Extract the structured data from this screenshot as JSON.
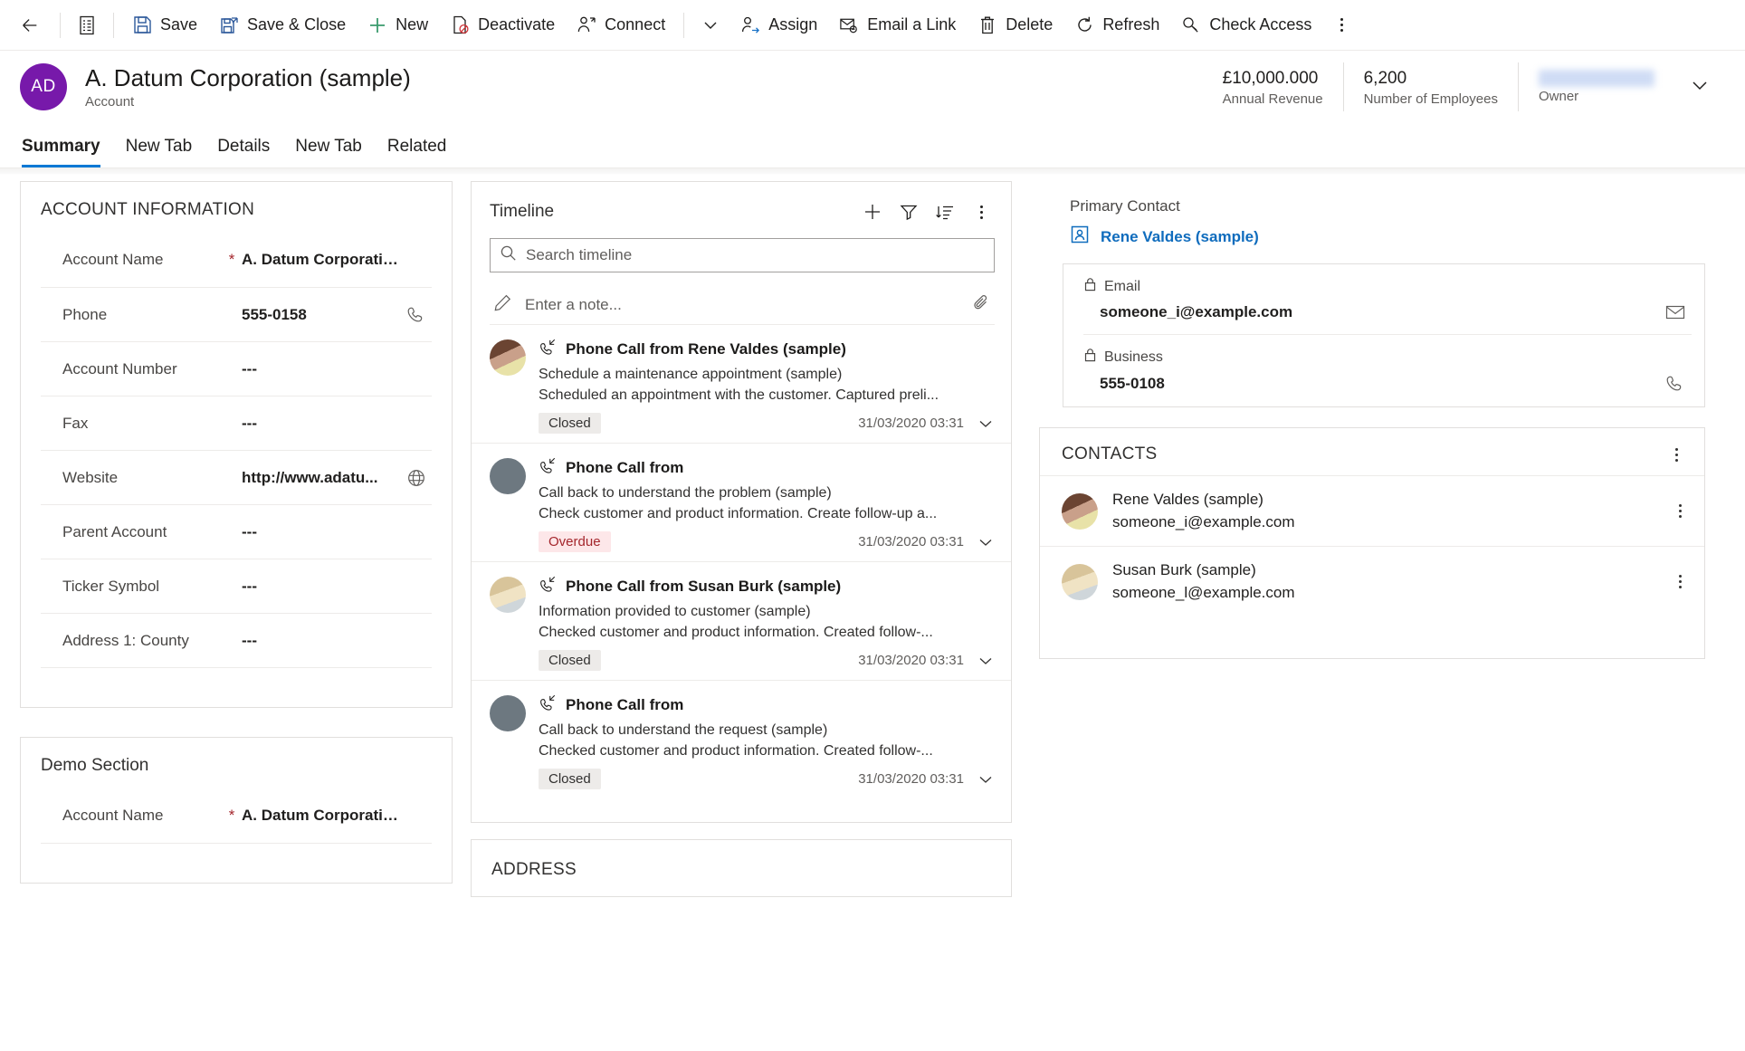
{
  "commandbar": {
    "back_label": "Back",
    "form_selector_label": "Form selector",
    "items": [
      {
        "label": "Save",
        "icon": "save-icon"
      },
      {
        "label": "Save & Close",
        "icon": "save-close-icon"
      },
      {
        "label": "New",
        "icon": "plus-icon"
      },
      {
        "label": "Deactivate",
        "icon": "deactivate-icon"
      },
      {
        "label": "Connect",
        "icon": "connect-icon"
      }
    ],
    "overflow_chevron": "chevron-down-icon",
    "items2": [
      {
        "label": "Assign",
        "icon": "assign-icon"
      },
      {
        "label": "Email a Link",
        "icon": "email-link-icon"
      },
      {
        "label": "Delete",
        "icon": "delete-icon"
      },
      {
        "label": "Refresh",
        "icon": "refresh-icon"
      },
      {
        "label": "Check Access",
        "icon": "key-icon"
      }
    ],
    "more_label": "More commands"
  },
  "header": {
    "avatar_initials": "AD",
    "title": "A. Datum Corporation (sample)",
    "subtitle": "Account",
    "stats": [
      {
        "value": "£10,000.000",
        "label": "Annual Revenue"
      },
      {
        "value": "6,200",
        "label": "Number of Employees"
      },
      {
        "value": "",
        "label": "Owner",
        "redacted": true
      }
    ]
  },
  "tabs": [
    {
      "label": "Summary",
      "active": true
    },
    {
      "label": "New Tab",
      "active": false
    },
    {
      "label": "Details",
      "active": false
    },
    {
      "label": "New Tab",
      "active": false
    },
    {
      "label": "Related",
      "active": false
    }
  ],
  "account_information": {
    "title": "ACCOUNT INFORMATION",
    "fields": [
      {
        "label": "Account Name",
        "required": true,
        "value": "A. Datum Corporation ...",
        "icon": ""
      },
      {
        "label": "Phone",
        "required": false,
        "value": "555-0158",
        "icon": "phone-icon"
      },
      {
        "label": "Account Number",
        "required": false,
        "value": "---",
        "icon": ""
      },
      {
        "label": "Fax",
        "required": false,
        "value": "---",
        "icon": ""
      },
      {
        "label": "Website",
        "required": false,
        "value": "http://www.adatu...",
        "icon": "globe-icon"
      },
      {
        "label": "Parent Account",
        "required": false,
        "value": "---",
        "icon": ""
      },
      {
        "label": "Ticker Symbol",
        "required": false,
        "value": "---",
        "icon": ""
      },
      {
        "label": "Address 1: County",
        "required": false,
        "value": "---",
        "icon": ""
      }
    ]
  },
  "demo_section": {
    "title": "Demo Section",
    "fields": [
      {
        "label": "Account Name",
        "required": true,
        "value": "A. Datum Corporation ...",
        "icon": ""
      }
    ]
  },
  "timeline": {
    "title": "Timeline",
    "actions": [
      {
        "name": "add-icon",
        "label": "Create a timeline record"
      },
      {
        "name": "filter-icon",
        "label": "Filter timeline"
      },
      {
        "name": "sort-icon",
        "label": "Sort timeline"
      },
      {
        "name": "more-icon",
        "label": "More timeline commands"
      }
    ],
    "search_placeholder": "Search timeline",
    "note_placeholder": "Enter a note...",
    "attach_label": "Attach file",
    "items": [
      {
        "title": "Phone Call from Rene Valdes (sample)",
        "subject": "Schedule a maintenance appointment (sample)",
        "description": "Scheduled an appointment with the customer. Captured preli...",
        "status": "Closed",
        "status_kind": "closed",
        "date": "31/03/2020 03:31",
        "avatar": "photo-female-1"
      },
      {
        "title": "Phone Call from",
        "subject": "Call back to understand the problem (sample)",
        "description": "Check customer and product information. Create follow-up a...",
        "status": "Overdue",
        "status_kind": "overdue",
        "date": "31/03/2020 03:31",
        "avatar": "placeholder"
      },
      {
        "title": "Phone Call from Susan Burk (sample)",
        "subject": "Information provided to customer (sample)",
        "description": "Checked customer and product information. Created follow-...",
        "status": "Closed",
        "status_kind": "closed",
        "date": "31/03/2020 03:31",
        "avatar": "photo-female-2"
      },
      {
        "title": "Phone Call from",
        "subject": "Call back to understand the request (sample)",
        "description": "Checked customer and product information. Created follow-...",
        "status": "Closed",
        "status_kind": "closed",
        "date": "31/03/2020 03:31",
        "avatar": "placeholder"
      }
    ]
  },
  "address": {
    "title": "ADDRESS"
  },
  "right_panel": {
    "primary_contact_label": "Primary Contact",
    "primary_contact_name": "Rene Valdes (sample)",
    "fields": [
      {
        "label": "Email",
        "value": "someone_i@example.com",
        "lock": true,
        "icon": "mail-icon"
      },
      {
        "label": "Business",
        "value": "555-0108",
        "lock": true,
        "icon": "phone-icon"
      }
    ],
    "contacts_title": "CONTACTS",
    "contacts_more_label": "More contacts commands",
    "contacts": [
      {
        "name": "Rene Valdes (sample)",
        "email": "someone_i@example.com",
        "avatar": "photo-female-1"
      },
      {
        "name": "Susan Burk (sample)",
        "email": "someone_l@example.com",
        "avatar": "photo-female-2"
      }
    ]
  },
  "colors": {
    "accent": "#0078d4",
    "link": "#0f6cbd",
    "avatar": "#7719aa",
    "required": "#a4262c",
    "overdue_bg": "#fde7e9"
  }
}
